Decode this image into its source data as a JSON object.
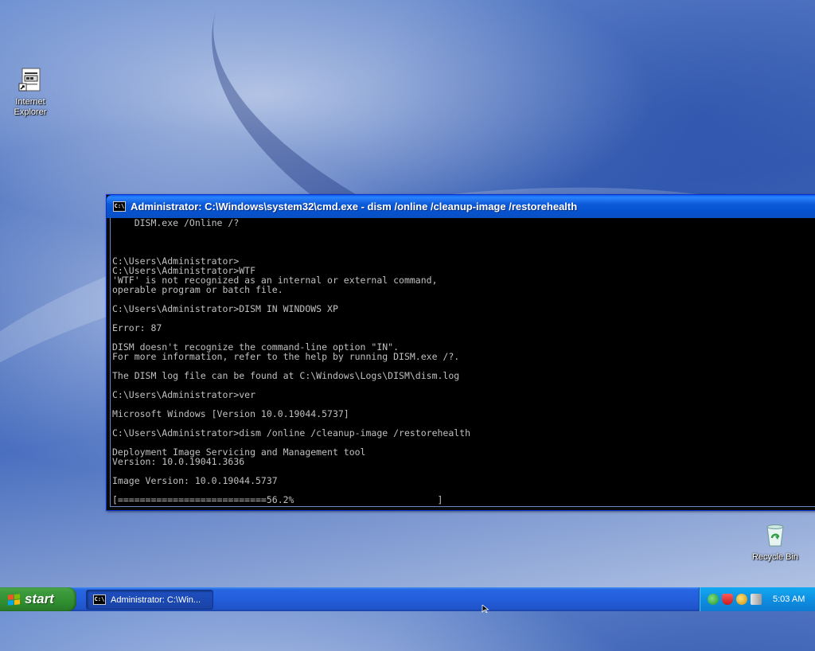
{
  "desktop": {
    "icons": [
      {
        "label": "Internet\nExplorer",
        "icon": "internet-explorer-shortcut-icon"
      },
      {
        "label": "Recycle Bin",
        "icon": "recycle-bin-icon"
      }
    ]
  },
  "cmd_window": {
    "title": "Administrator: C:\\Windows\\system32\\cmd.exe - dism  /online /cleanup-image /restorehealth",
    "icon": "cmd-icon",
    "icon_text": "C:\\",
    "console_lines": [
      "    DISM.exe /Online /?",
      "",
      "",
      "",
      "C:\\Users\\Administrator>",
      "C:\\Users\\Administrator>WTF",
      "'WTF' is not recognized as an internal or external command,",
      "operable program or batch file.",
      "",
      "C:\\Users\\Administrator>DISM IN WINDOWS XP",
      "",
      "Error: 87",
      "",
      "DISM doesn't recognize the command-line option \"IN\".",
      "For more information, refer to the help by running DISM.exe /?.",
      "",
      "The DISM log file can be found at C:\\Windows\\Logs\\DISM\\dism.log",
      "",
      "C:\\Users\\Administrator>ver",
      "",
      "Microsoft Windows [Version 10.0.19044.5737]",
      "",
      "C:\\Users\\Administrator>dism /online /cleanup-image /restorehealth",
      "",
      "Deployment Image Servicing and Management tool",
      "Version: 10.0.19041.3636",
      "",
      "Image Version: 10.0.19044.5737",
      "",
      "[===========================56.2%                          ]"
    ],
    "progress_percent": 56.2
  },
  "taskbar": {
    "start_label": "start",
    "task_label": "Administrator: C:\\Win...",
    "clock": "5:03 AM",
    "tray_icons": [
      "network-icon",
      "security-shield-icon",
      "update-icon",
      "volume-icon"
    ],
    "colors": {
      "start_green": "#3c9a3c",
      "taskbar_blue": "#245edb",
      "tray_blue": "#0f8fe2"
    }
  }
}
